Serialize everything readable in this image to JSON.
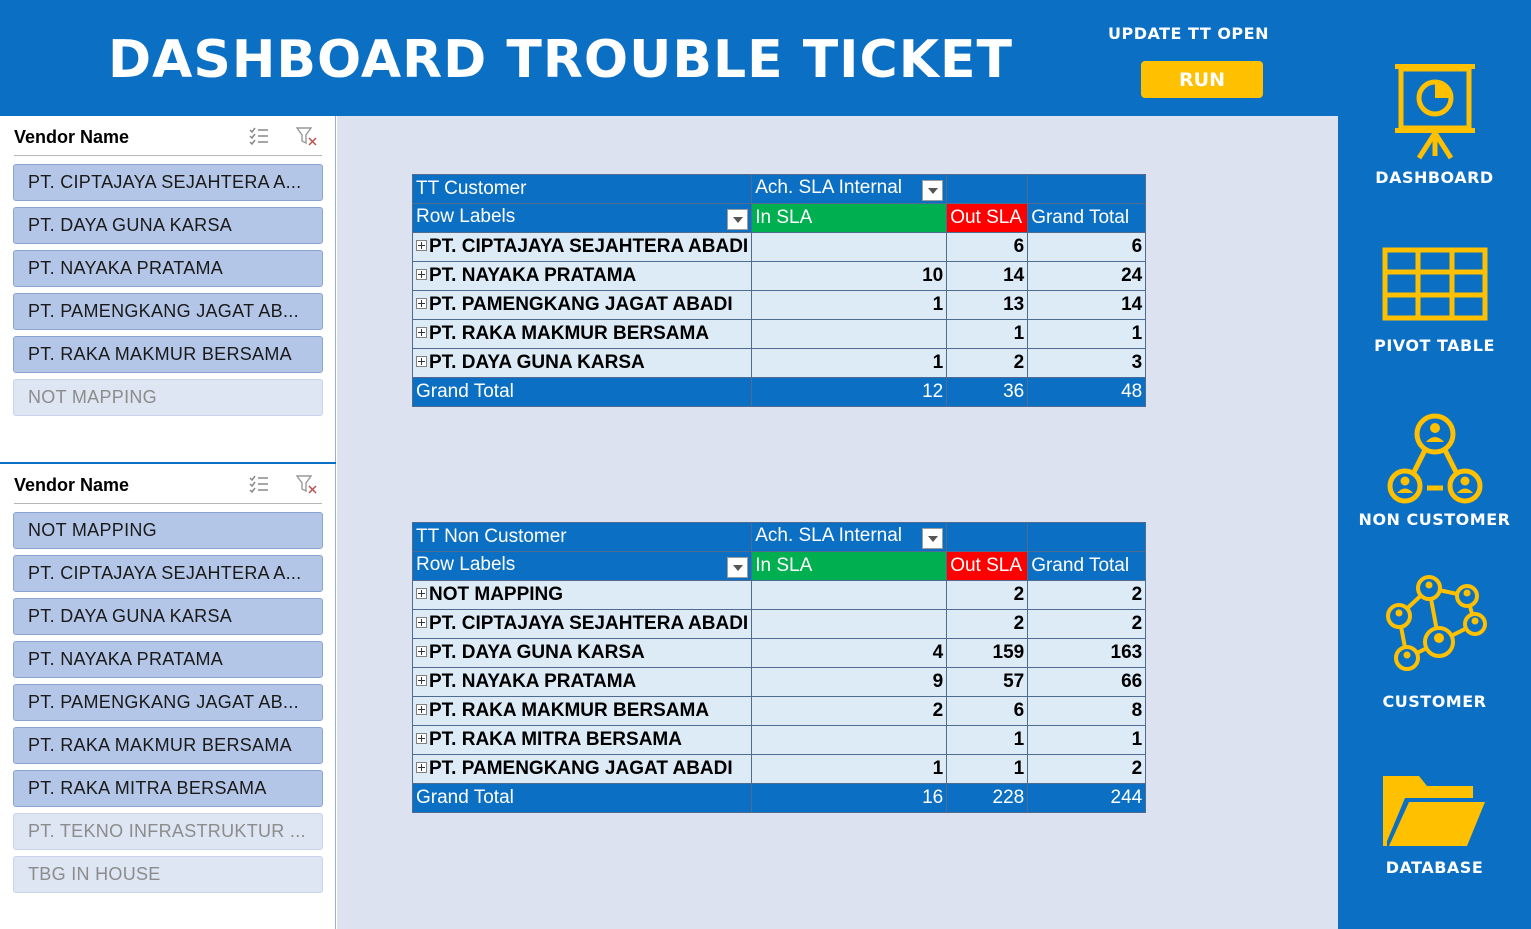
{
  "header": {
    "title": "DASHBOARD TROUBLE TICKET",
    "update_label": "UPDATE TT OPEN",
    "run_label": "RUN"
  },
  "colors": {
    "primary_blue": "#0b6fc4",
    "accent_yellow": "#ffc000",
    "in_sla_green": "#00b050",
    "out_sla_red": "#ff0000",
    "row_bg": "#ddebf7",
    "slicer_selected": "#b4c6e7",
    "slicer_unselected": "#dee5f3"
  },
  "nav": {
    "items": [
      {
        "label": "DASHBOARD",
        "icon": "presentation-chart-icon"
      },
      {
        "label": "PIVOT TABLE",
        "icon": "table-grid-icon"
      },
      {
        "label": "NON CUSTOMER",
        "icon": "people-network-icon"
      },
      {
        "label": "CUSTOMER",
        "icon": "connected-people-icon"
      },
      {
        "label": "DATABASE",
        "icon": "folder-icon"
      }
    ]
  },
  "slicers": [
    {
      "title": "Vendor Name",
      "items": [
        {
          "label": "PT. CIPTAJAYA SEJAHTERA A...",
          "selected": true
        },
        {
          "label": "PT. DAYA GUNA KARSA",
          "selected": true
        },
        {
          "label": "PT. NAYAKA PRATAMA",
          "selected": true
        },
        {
          "label": "PT. PAMENGKANG JAGAT AB...",
          "selected": true
        },
        {
          "label": "PT. RAKA MAKMUR BERSAMA",
          "selected": true
        },
        {
          "label": "NOT MAPPING",
          "selected": false
        }
      ]
    },
    {
      "title": "Vendor Name",
      "items": [
        {
          "label": "NOT MAPPING",
          "selected": true
        },
        {
          "label": "PT. CIPTAJAYA SEJAHTERA A...",
          "selected": true
        },
        {
          "label": "PT. DAYA GUNA KARSA",
          "selected": true
        },
        {
          "label": "PT. NAYAKA PRATAMA",
          "selected": true
        },
        {
          "label": "PT. PAMENGKANG JAGAT AB...",
          "selected": true
        },
        {
          "label": "PT. RAKA MAKMUR BERSAMA",
          "selected": true
        },
        {
          "label": "PT. RAKA MITRA BERSAMA",
          "selected": true
        },
        {
          "label": "PT. TEKNO INFRASTRUKTUR ...",
          "selected": false
        },
        {
          "label": "TBG IN HOUSE",
          "selected": false
        }
      ]
    }
  ],
  "pivots": [
    {
      "title": "TT Customer",
      "column_field": "Ach. SLA Internal",
      "row_labels_header": "Row Labels",
      "col_in": "In SLA",
      "col_out": "Out SLA",
      "col_total": "Grand Total",
      "rows": [
        {
          "label": "PT. CIPTAJAYA SEJAHTERA ABADI",
          "in": "",
          "out": "6",
          "total": "6"
        },
        {
          "label": "PT. NAYAKA PRATAMA",
          "in": "10",
          "out": "14",
          "total": "24"
        },
        {
          "label": "PT. PAMENGKANG JAGAT ABADI",
          "in": "1",
          "out": "13",
          "total": "14"
        },
        {
          "label": "PT. RAKA MAKMUR BERSAMA",
          "in": "",
          "out": "1",
          "total": "1"
        },
        {
          "label": "PT. DAYA GUNA KARSA",
          "in": "1",
          "out": "2",
          "total": "3"
        }
      ],
      "grand_total": {
        "label": "Grand Total",
        "in": "12",
        "out": "36",
        "total": "48"
      }
    },
    {
      "title": "TT Non Customer",
      "column_field": "Ach. SLA Internal",
      "row_labels_header": "Row Labels",
      "col_in": "In SLA",
      "col_out": "Out SLA",
      "col_total": "Grand Total",
      "rows": [
        {
          "label": "NOT MAPPING",
          "in": "",
          "out": "2",
          "total": "2"
        },
        {
          "label": "PT. CIPTAJAYA SEJAHTERA ABADI",
          "in": "",
          "out": "2",
          "total": "2"
        },
        {
          "label": "PT. DAYA GUNA KARSA",
          "in": "4",
          "out": "159",
          "total": "163"
        },
        {
          "label": "PT. NAYAKA PRATAMA",
          "in": "9",
          "out": "57",
          "total": "66"
        },
        {
          "label": "PT. RAKA MAKMUR BERSAMA",
          "in": "2",
          "out": "6",
          "total": "8"
        },
        {
          "label": "PT. RAKA MITRA BERSAMA",
          "in": "",
          "out": "1",
          "total": "1"
        },
        {
          "label": "PT. PAMENGKANG JAGAT ABADI",
          "in": "1",
          "out": "1",
          "total": "2"
        }
      ],
      "grand_total": {
        "label": "Grand Total",
        "in": "16",
        "out": "228",
        "total": "244"
      }
    }
  ]
}
